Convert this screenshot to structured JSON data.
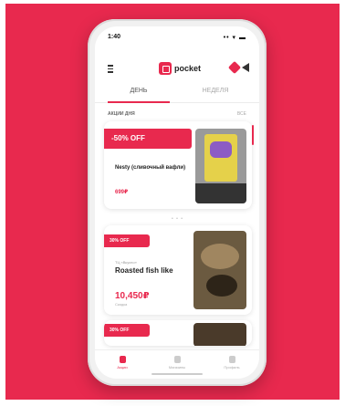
{
  "status": {
    "time": "1:40",
    "signal": "•• ▾ ▬"
  },
  "app": {
    "logo_text": "pocket"
  },
  "tabs": [
    {
      "label": "ДЕНЬ"
    },
    {
      "label": "НЕДЕЛЯ"
    }
  ],
  "section": {
    "label": "АКЦИИ ДНЯ",
    "see_all": "ВСЕ"
  },
  "cards": [
    {
      "badge": "-50% OFF",
      "title": "Nesty (сливочный вафли)",
      "price": "699₽"
    },
    {
      "badge": "30% OFF",
      "subtitle": "ТЦ «Вкусно»",
      "title": "Roasted fish like",
      "price": "10,450₽",
      "note": "Скидка"
    },
    {
      "badge": "30% OFF"
    }
  ],
  "carousel": {
    "dots": "• • •"
  },
  "bottom_nav": [
    {
      "label": "Акции"
    },
    {
      "label": "Магазины"
    },
    {
      "label": "Профиль"
    }
  ],
  "colors": {
    "accent": "#e8294e"
  }
}
